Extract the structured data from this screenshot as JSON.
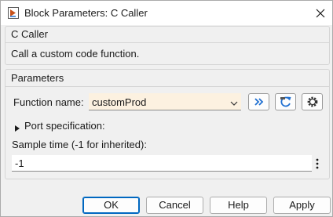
{
  "window": {
    "title": "Block Parameters: C Caller"
  },
  "block_panel": {
    "title": "C Caller",
    "description": "Call a custom code function."
  },
  "params_panel": {
    "title": "Parameters",
    "function_name_label": "Function name:",
    "function_name_value": "customProd",
    "port_spec_label": "Port specification:",
    "sample_time_label": "Sample time (-1 for inherited):",
    "sample_time_value": "-1"
  },
  "buttons": {
    "ok": "OK",
    "cancel": "Cancel",
    "help": "Help",
    "apply": "Apply"
  },
  "colors": {
    "combo_bg": "#fcf1e0",
    "default_button_border": "#0067c0",
    "icon_blue": "#1f6fd1"
  },
  "icons": [
    "simulink-block-icon",
    "close-icon",
    "chevron-down-icon",
    "double-chevron-right-icon",
    "refresh-icon",
    "gear-icon",
    "expand-triangle-icon",
    "kebab-menu-icon"
  ]
}
